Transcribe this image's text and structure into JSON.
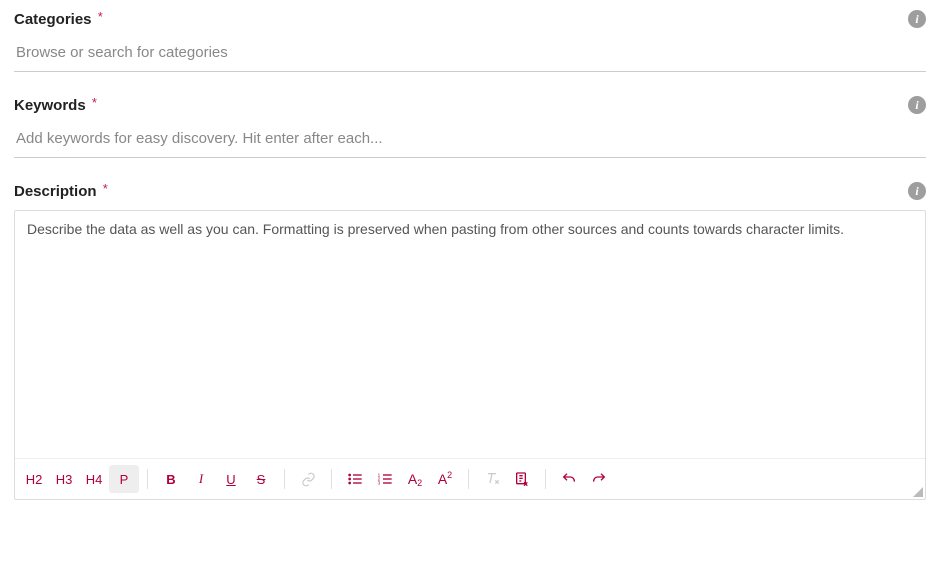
{
  "fields": {
    "categories": {
      "label": "Categories",
      "required_marker": "*",
      "placeholder": "Browse or search for categories"
    },
    "keywords": {
      "label": "Keywords",
      "required_marker": "*",
      "placeholder": "Add keywords for easy discovery. Hit enter after each..."
    },
    "description": {
      "label": "Description",
      "required_marker": "*",
      "placeholder": "Describe the data as well as you can. Formatting is preserved when pasting from other sources and counts towards character limits."
    }
  },
  "toolbar": {
    "h2": "H2",
    "h3": "H3",
    "h4": "H4",
    "p": "P",
    "bold": "B",
    "italic": "I",
    "underline": "U",
    "strike": "S",
    "sub_label": "A",
    "sub_suffix": "2",
    "sup_label": "A",
    "sup_suffix": "2"
  },
  "info_glyph": "i"
}
